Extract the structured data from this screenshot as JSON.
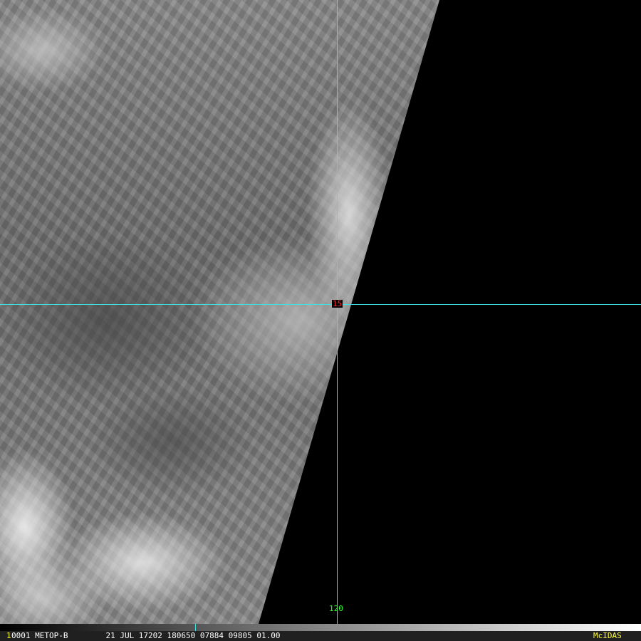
{
  "image": {
    "description_free": true
  },
  "gridlines": {
    "latitude_label": "15",
    "longitude_label": "120",
    "color": "#3fe0e0",
    "lat_color": "#ff3030",
    "lon_color": "#30ff30"
  },
  "status_bar": {
    "frame_number": "1",
    "info": "0001 METOP-B        21 JUL 17202 180650 07884 09805 01.00",
    "brand": "McIDAS"
  }
}
